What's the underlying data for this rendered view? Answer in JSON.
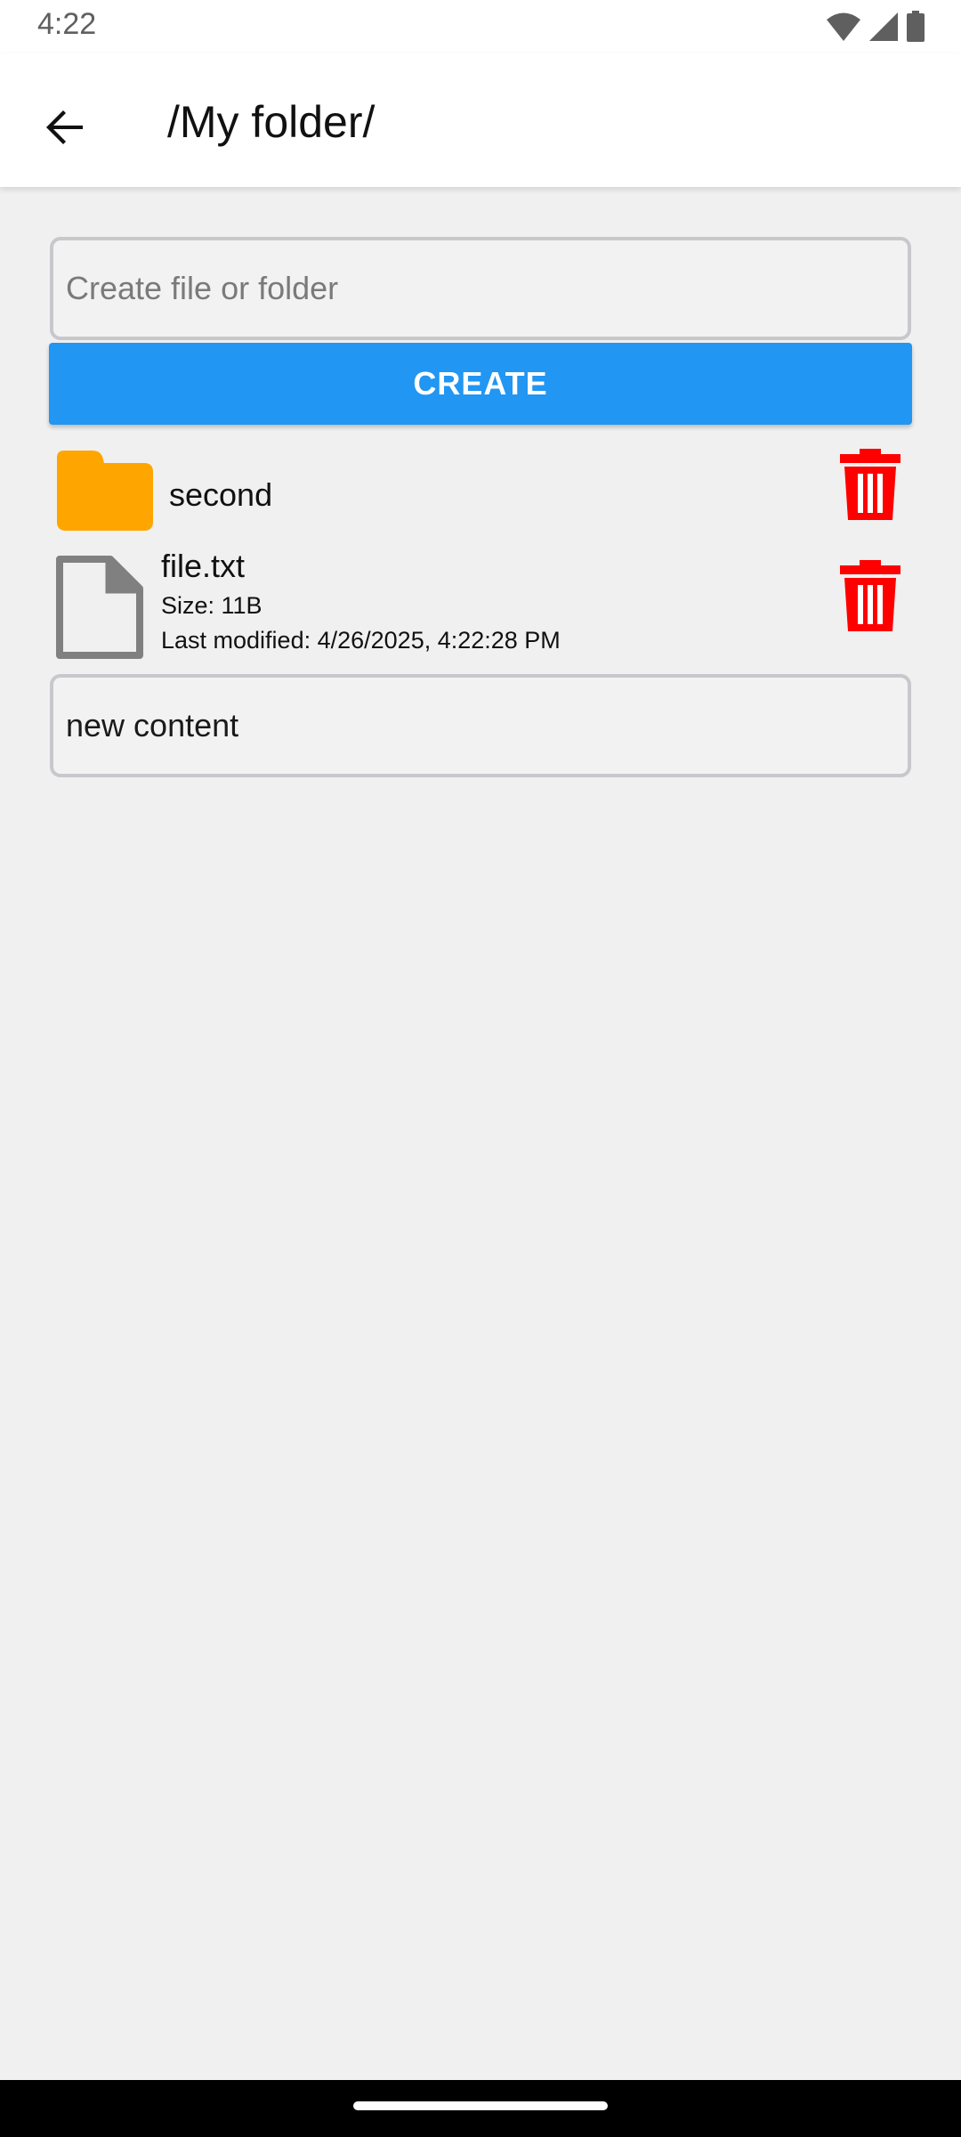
{
  "status_bar": {
    "time": "4:22",
    "icons": [
      "wifi-icon",
      "cellular-signal-icon",
      "battery-icon"
    ]
  },
  "app_bar": {
    "back_icon": "arrow-back-icon",
    "title": "/My folder/"
  },
  "create": {
    "placeholder": "Create file or folder",
    "value": "",
    "button_label": "CREATE"
  },
  "items": [
    {
      "type": "folder",
      "name": "second",
      "icon": "folder-icon",
      "delete_icon": "trash-icon"
    },
    {
      "type": "file",
      "name": "file.txt",
      "size": "Size: 11B",
      "modified": "Last modified: 4/26/2025, 4:22:28 PM",
      "icon": "file-icon",
      "delete_icon": "trash-icon"
    }
  ],
  "editor": {
    "value": "new content"
  },
  "colors": {
    "accent": "#2196f3",
    "folder": "#ffa500",
    "delete": "#ff0000",
    "file_icon": "#808080",
    "background": "#f0f0f0"
  }
}
